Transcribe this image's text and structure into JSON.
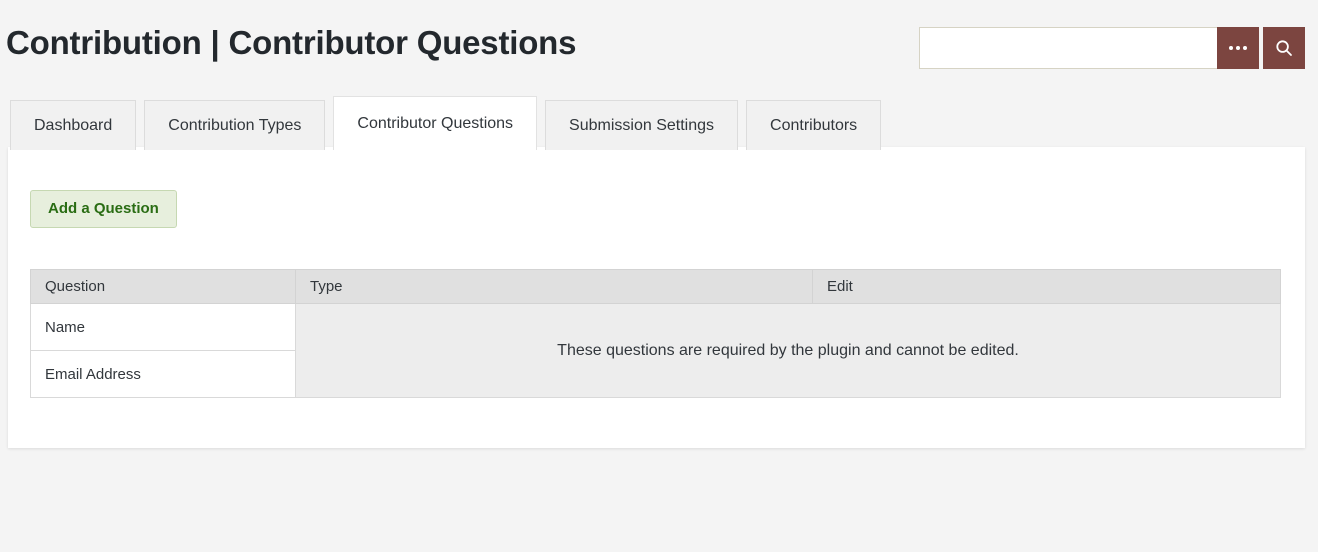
{
  "header": {
    "title": "Contribution | Contributor Questions",
    "search": {
      "value": "",
      "placeholder": "",
      "more_icon": "ellipsis-icon",
      "search_icon": "search-icon"
    }
  },
  "tabs": [
    {
      "label": "Dashboard",
      "active": false
    },
    {
      "label": "Contribution Types",
      "active": false
    },
    {
      "label": "Contributor Questions",
      "active": true
    },
    {
      "label": "Submission Settings",
      "active": false
    },
    {
      "label": "Contributors",
      "active": false
    }
  ],
  "main": {
    "add_button_label": "Add a Question",
    "table": {
      "columns": [
        "Question",
        "Type",
        "Edit"
      ],
      "rows": [
        {
          "question": "Name"
        },
        {
          "question": "Email Address"
        }
      ],
      "merged_message": "These questions are required by the plugin and cannot be edited."
    }
  },
  "colors": {
    "page_background": "#f4f4f4",
    "panel_background": "#ffffff",
    "accent_button": "#7c4540",
    "add_button_text": "#2a6d14",
    "add_button_background": "#e7efdd",
    "table_header_background": "#e0e0e0",
    "table_message_background": "#ededed",
    "text": "#32373c"
  }
}
